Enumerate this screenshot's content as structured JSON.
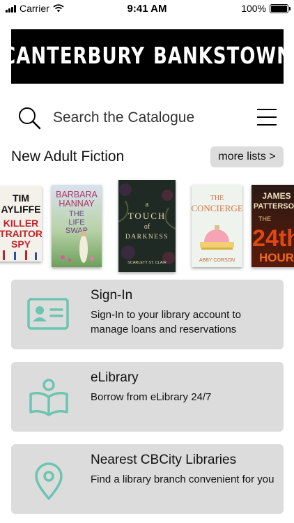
{
  "status_bar": {
    "carrier": "Carrier",
    "time": "9:41 AM",
    "battery": "100%"
  },
  "banner": {
    "left_word": "CANTERBURY",
    "right_word": "BANKSTOWN"
  },
  "search": {
    "placeholder": "Search the Catalogue"
  },
  "section": {
    "title": "New Adult Fiction",
    "more_button": "more lists >"
  },
  "books": [
    {
      "cover_text": [
        "TIM",
        "AYLIFFE",
        "KILLER",
        "TRAITOR",
        "SPY"
      ],
      "colors": {
        "bg": "#f4f1ea",
        "accent": "#c0222a"
      }
    },
    {
      "cover_text": [
        "BARBARA",
        "HANNAY",
        "THE",
        "LIFE",
        "SWAP"
      ],
      "colors": {
        "bg": "#9fc59a",
        "accent": "#b2306f"
      }
    },
    {
      "cover_text": [
        "a",
        "TOUCH",
        "of",
        "DARKNESS",
        "SCARLETT ST. CLAIR"
      ],
      "colors": {
        "bg": "#1f2a24",
        "accent": "#e8d8b0"
      }
    },
    {
      "cover_text": [
        "THE",
        "CONCIERGE",
        "ABBY CORSON"
      ],
      "colors": {
        "bg": "#eef3ee",
        "accent": "#d8763a"
      }
    },
    {
      "cover_text": [
        "JAMES",
        "PATTERSON",
        "THE",
        "24th",
        "HOUR"
      ],
      "colors": {
        "bg": "#1a1010",
        "accent": "#d83a10"
      }
    }
  ],
  "cards": [
    {
      "title": "Sign-In",
      "description": "Sign-In to your library account to manage loans and reservations",
      "icon": "id-card-icon"
    },
    {
      "title": "eLibrary",
      "description": "Borrow from eLibrary 24/7",
      "icon": "reader-book-icon"
    },
    {
      "title": "Nearest CBCity Libraries",
      "description": "Find a library branch convenient for you",
      "icon": "map-pin-icon"
    }
  ],
  "colors": {
    "icon_teal": "#6cc5b0",
    "card_bg": "#dcdcdc",
    "banner_bg": "#000000"
  }
}
